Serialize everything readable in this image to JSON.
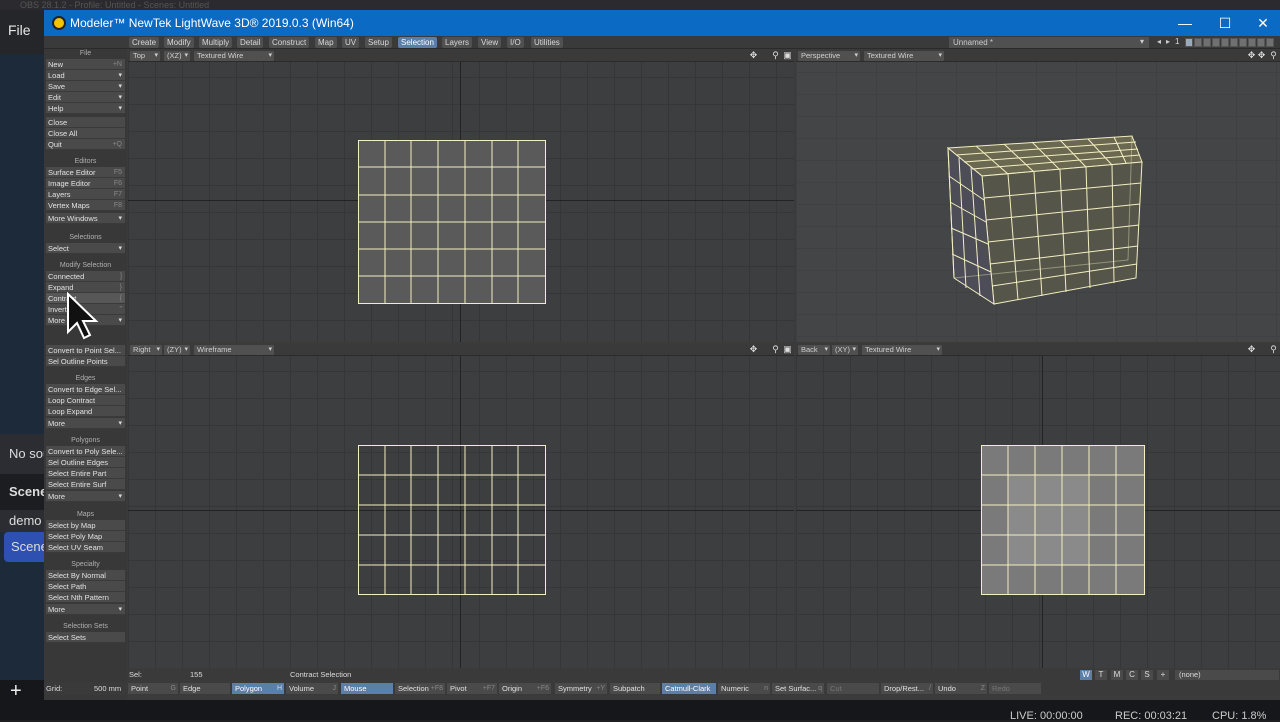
{
  "obs": {
    "title": "OBS 28.1.2 - Profile: Untitled - Scenes: Untitled",
    "menu_file": "File",
    "panels": [
      "No sou",
      "Scene",
      "demo",
      "Scene"
    ],
    "add_icon": "+",
    "status_live": "LIVE: 00:00:00",
    "status_rec": "REC: 00:03:21",
    "status_cpu": "CPU: 1.8%"
  },
  "window": {
    "title": "Modeler™ NewTek LightWave 3D® 2019.0.3 (Win64)",
    "minimize": "—",
    "maximize": "☐",
    "close": "✕"
  },
  "tabs": [
    "Create",
    "Modify",
    "Multiply",
    "Detail",
    "Construct",
    "Map",
    "UV",
    "Setup",
    "Selection",
    "Layers",
    "View",
    "I/O",
    "Utilities"
  ],
  "active_tab": "Selection",
  "layer_name": "Unnamed *",
  "layer_number": "1",
  "toolbar": {
    "file_head": "File",
    "file_items": [
      {
        "label": "New",
        "key": "+N",
        "dd": false
      },
      {
        "label": "Load",
        "key": "",
        "dd": true
      },
      {
        "label": "Save",
        "key": "",
        "dd": true
      },
      {
        "label": "Edit",
        "key": "",
        "dd": true
      },
      {
        "label": "Help",
        "key": "",
        "dd": true
      }
    ],
    "file_items2": [
      {
        "label": "Close",
        "key": ""
      },
      {
        "label": "Close All",
        "key": ""
      },
      {
        "label": "Quit",
        "key": "+Q"
      }
    ],
    "editors_head": "Editors",
    "editors_items": [
      {
        "label": "Surface Editor",
        "key": "F5"
      },
      {
        "label": "Image Editor",
        "key": "F6"
      },
      {
        "label": "Layers",
        "key": "F7"
      },
      {
        "label": "Vertex Maps",
        "key": "F8"
      },
      {
        "label": "More Windows",
        "key": "▾"
      }
    ],
    "selections_head": "Selections",
    "selections_items": [
      {
        "label": "Select",
        "key": "▾"
      }
    ],
    "modify_head": "Modify Selection",
    "modify_items": [
      {
        "label": "Connected",
        "key": "]"
      },
      {
        "label": "Expand",
        "key": "}"
      },
      {
        "label": "Contract",
        "key": "{"
      },
      {
        "label": "Invert",
        "key": "\""
      },
      {
        "label": "More",
        "key": "▾"
      }
    ],
    "points_items": [
      {
        "label": "Convert to Point Sel...",
        "key": ""
      },
      {
        "label": "Sel Outline Points",
        "key": ""
      }
    ],
    "edges_head": "Edges",
    "edges_items": [
      {
        "label": "Convert to Edge Sel...",
        "key": ""
      },
      {
        "label": "Loop Contract",
        "key": ""
      },
      {
        "label": "Loop Expand",
        "key": ""
      },
      {
        "label": "More",
        "key": "▾"
      }
    ],
    "polygons_head": "Polygons",
    "polygons_items": [
      {
        "label": "Convert to Poly Sele...",
        "key": ""
      },
      {
        "label": "Sel Outline Edges",
        "key": ""
      },
      {
        "label": "Select Entire Part",
        "key": ""
      },
      {
        "label": "Select Entire Surf",
        "key": ""
      },
      {
        "label": "More",
        "key": "▾"
      }
    ],
    "maps_head": "Maps",
    "maps_items": [
      {
        "label": "Select by Map",
        "key": ""
      },
      {
        "label": "Select Poly Map",
        "key": ""
      },
      {
        "label": "Select UV Seam",
        "key": ""
      }
    ],
    "specialty_head": "Specialty",
    "specialty_items": [
      {
        "label": "Select By Normal",
        "key": ""
      },
      {
        "label": "Select Path",
        "key": ""
      },
      {
        "label": "Select Nth Pattern",
        "key": ""
      },
      {
        "label": "More",
        "key": "▾"
      }
    ],
    "selsets_head": "Selection Sets",
    "selsets_items": [
      {
        "label": "Select Sets",
        "key": ""
      }
    ]
  },
  "viewports": {
    "tl": {
      "view": "Top",
      "axis": "(XZ)",
      "mode": "Textured Wire"
    },
    "tr": {
      "view": "Perspective",
      "mode": "Textured Wire"
    },
    "bl": {
      "view": "Right",
      "axis": "(ZY)",
      "mode": "Wireframe"
    },
    "br": {
      "view": "Back",
      "axis": "(XY)",
      "mode": "Textured Wire"
    }
  },
  "infobar": {
    "sel_label": "Sel:",
    "sel_value": "155",
    "message": "Contract Selection",
    "wtmcs": [
      "W",
      "T",
      "M",
      "C",
      "S",
      "+"
    ],
    "surface": "(none)"
  },
  "modebar": {
    "grid_label": "Grid:",
    "grid_value": "500 mm",
    "buttons": [
      {
        "label": "Point",
        "key": "G"
      },
      {
        "label": "Edge",
        "key": ""
      },
      {
        "label": "Polygon",
        "key": "H"
      },
      {
        "label": "Volume",
        "key": "J"
      },
      {
        "label": "Mouse",
        "key": ""
      },
      {
        "label": "Selection",
        "key": "+F8"
      },
      {
        "label": "Pivot",
        "key": "+F7"
      },
      {
        "label": "Origin",
        "key": "+F6"
      },
      {
        "label": "Symmetry",
        "key": "+Y"
      },
      {
        "label": "Subpatch",
        "key": ""
      },
      {
        "label": "Catmull-Clark",
        "key": ""
      },
      {
        "label": "Numeric",
        "key": "n"
      },
      {
        "label": "Set Surfac...",
        "key": "q"
      },
      {
        "label": "Cut",
        "key": ""
      },
      {
        "label": "Drop/Rest...",
        "key": "/"
      },
      {
        "label": "Undo",
        "key": "Z"
      },
      {
        "label": "Redo",
        "key": ""
      }
    ]
  },
  "colors": {
    "accent": "#5a7fa8",
    "titlebar": "#0b6ac3",
    "wire": "#f3efc0",
    "panel": "#3a3a3a"
  }
}
